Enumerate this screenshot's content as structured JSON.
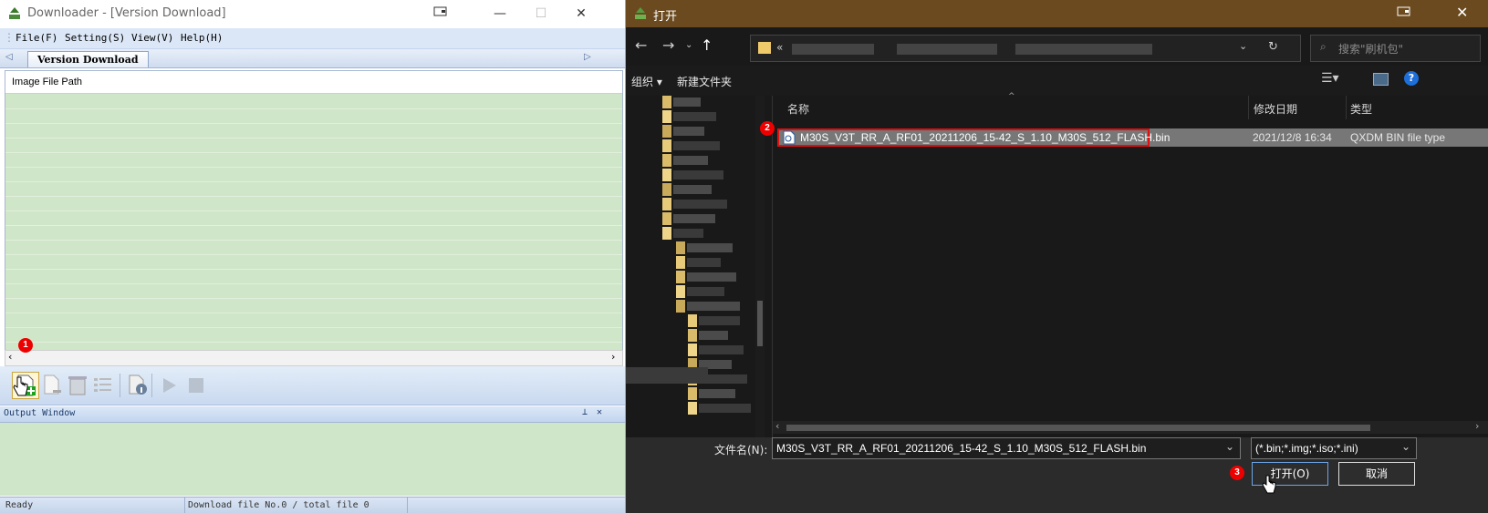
{
  "left_window": {
    "title": "Downloader - [Version Download]",
    "menus": [
      "File(F)",
      "Setting(S)",
      "View(V)",
      "Help(H)"
    ],
    "tab": "Version Download",
    "list_header": "Image File Path",
    "output_window": "Output Window",
    "status": {
      "ready": "Ready",
      "download": "Download file No.0 / total file 0"
    },
    "badge_add": "1"
  },
  "dialog": {
    "title": "打开",
    "search_placeholder": "搜索\"刷机包\"",
    "breadcrumb_prefix": "«",
    "commands": {
      "organize": "组织",
      "new_folder": "新建文件夹"
    },
    "columns": {
      "name": "名称",
      "date": "修改日期",
      "type": "类型"
    },
    "file": {
      "name": "M30S_V3T_RR_A_RF01_20211206_15-42_S_1.10_M30S_512_FLASH.bin",
      "date": "2021/12/8 16:34",
      "type": "QXDM BIN file type"
    },
    "badge_file": "2",
    "filename_label": "文件名(N):",
    "filename_value": "M30S_V3T_RR_A_RF01_20211206_15-42_S_1.10_M30S_512_FLASH.bin",
    "filter_value": "(*.bin;*.img;*.iso;*.ini)",
    "open_button": "打开(O)",
    "cancel_button": "取消",
    "badge_open": "3"
  },
  "colors": {
    "left_green": "#cfe6c8",
    "dialog_title": "#6b4a1f",
    "dialog_bg": "#1f1f1f",
    "highlight_red": "#e01010"
  }
}
